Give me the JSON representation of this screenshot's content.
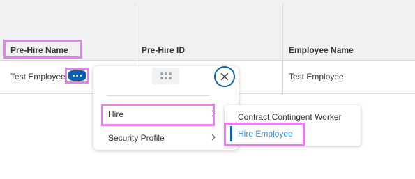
{
  "table": {
    "headers": [
      "Pre-Hire Name",
      "Pre-Hire ID",
      "Employee Name"
    ],
    "row": {
      "pre_hire_name": "Test Employee",
      "pre_hire_id": "",
      "employee_name": "Test Employee"
    }
  },
  "popup": {
    "menu_items": [
      {
        "label": "Hire"
      },
      {
        "label": "Security Profile"
      }
    ]
  },
  "submenu": {
    "items": [
      {
        "label": "Contract Contingent Worker"
      },
      {
        "label": "Hire Employee",
        "active": true
      }
    ]
  },
  "colors": {
    "accent": "#0a5fb4",
    "link": "#2f8ad6",
    "highlight": "#f07af5",
    "header_bg": "#f0f1f2"
  },
  "icons": [
    "more-icon",
    "drag-handle-icon",
    "close-icon",
    "chevron-right-icon"
  ]
}
